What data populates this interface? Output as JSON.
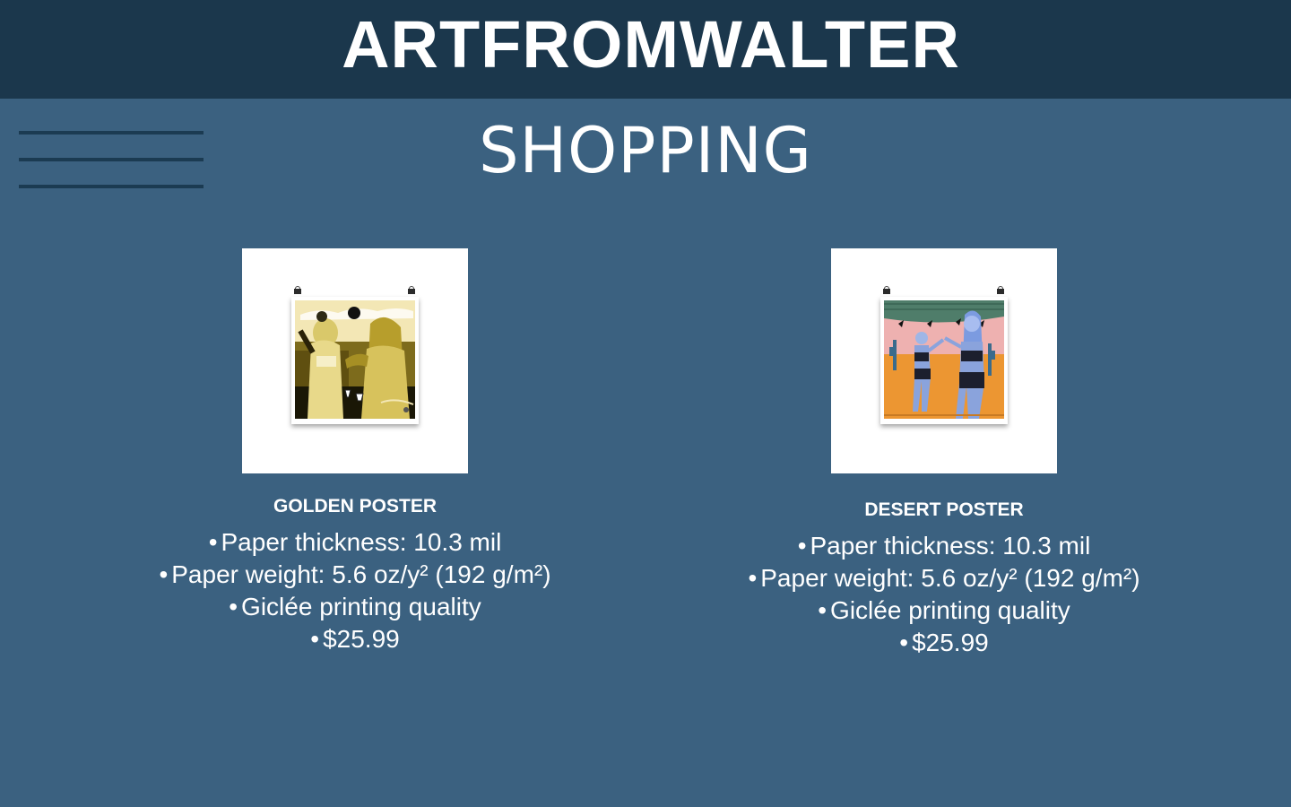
{
  "header": {
    "brand": "ARTFROMWALTER"
  },
  "nav": {
    "menu_icon": "hamburger-menu-icon"
  },
  "page": {
    "title": "SHOPPING"
  },
  "products": [
    {
      "name": "GOLDEN POSTER",
      "image": "golden-poster-thumbnail",
      "specs": [
        "Paper thickness: 10.3 mil",
        "Paper weight: 5.6 oz/y² (192 g/m²)",
        "Giclée printing quality",
        "$25.99"
      ]
    },
    {
      "name": "DESERT POSTER",
      "image": "desert-poster-thumbnail",
      "specs": [
        "Paper thickness: 10.3 mil",
        "Paper weight: 5.6 oz/y² (192 g/m²)",
        "Giclée printing quality",
        "$25.99"
      ]
    }
  ],
  "colors": {
    "background": "#3b6180",
    "header": "#1b374c",
    "menu_lines": "#1b3b52",
    "text": "#ffffff"
  }
}
